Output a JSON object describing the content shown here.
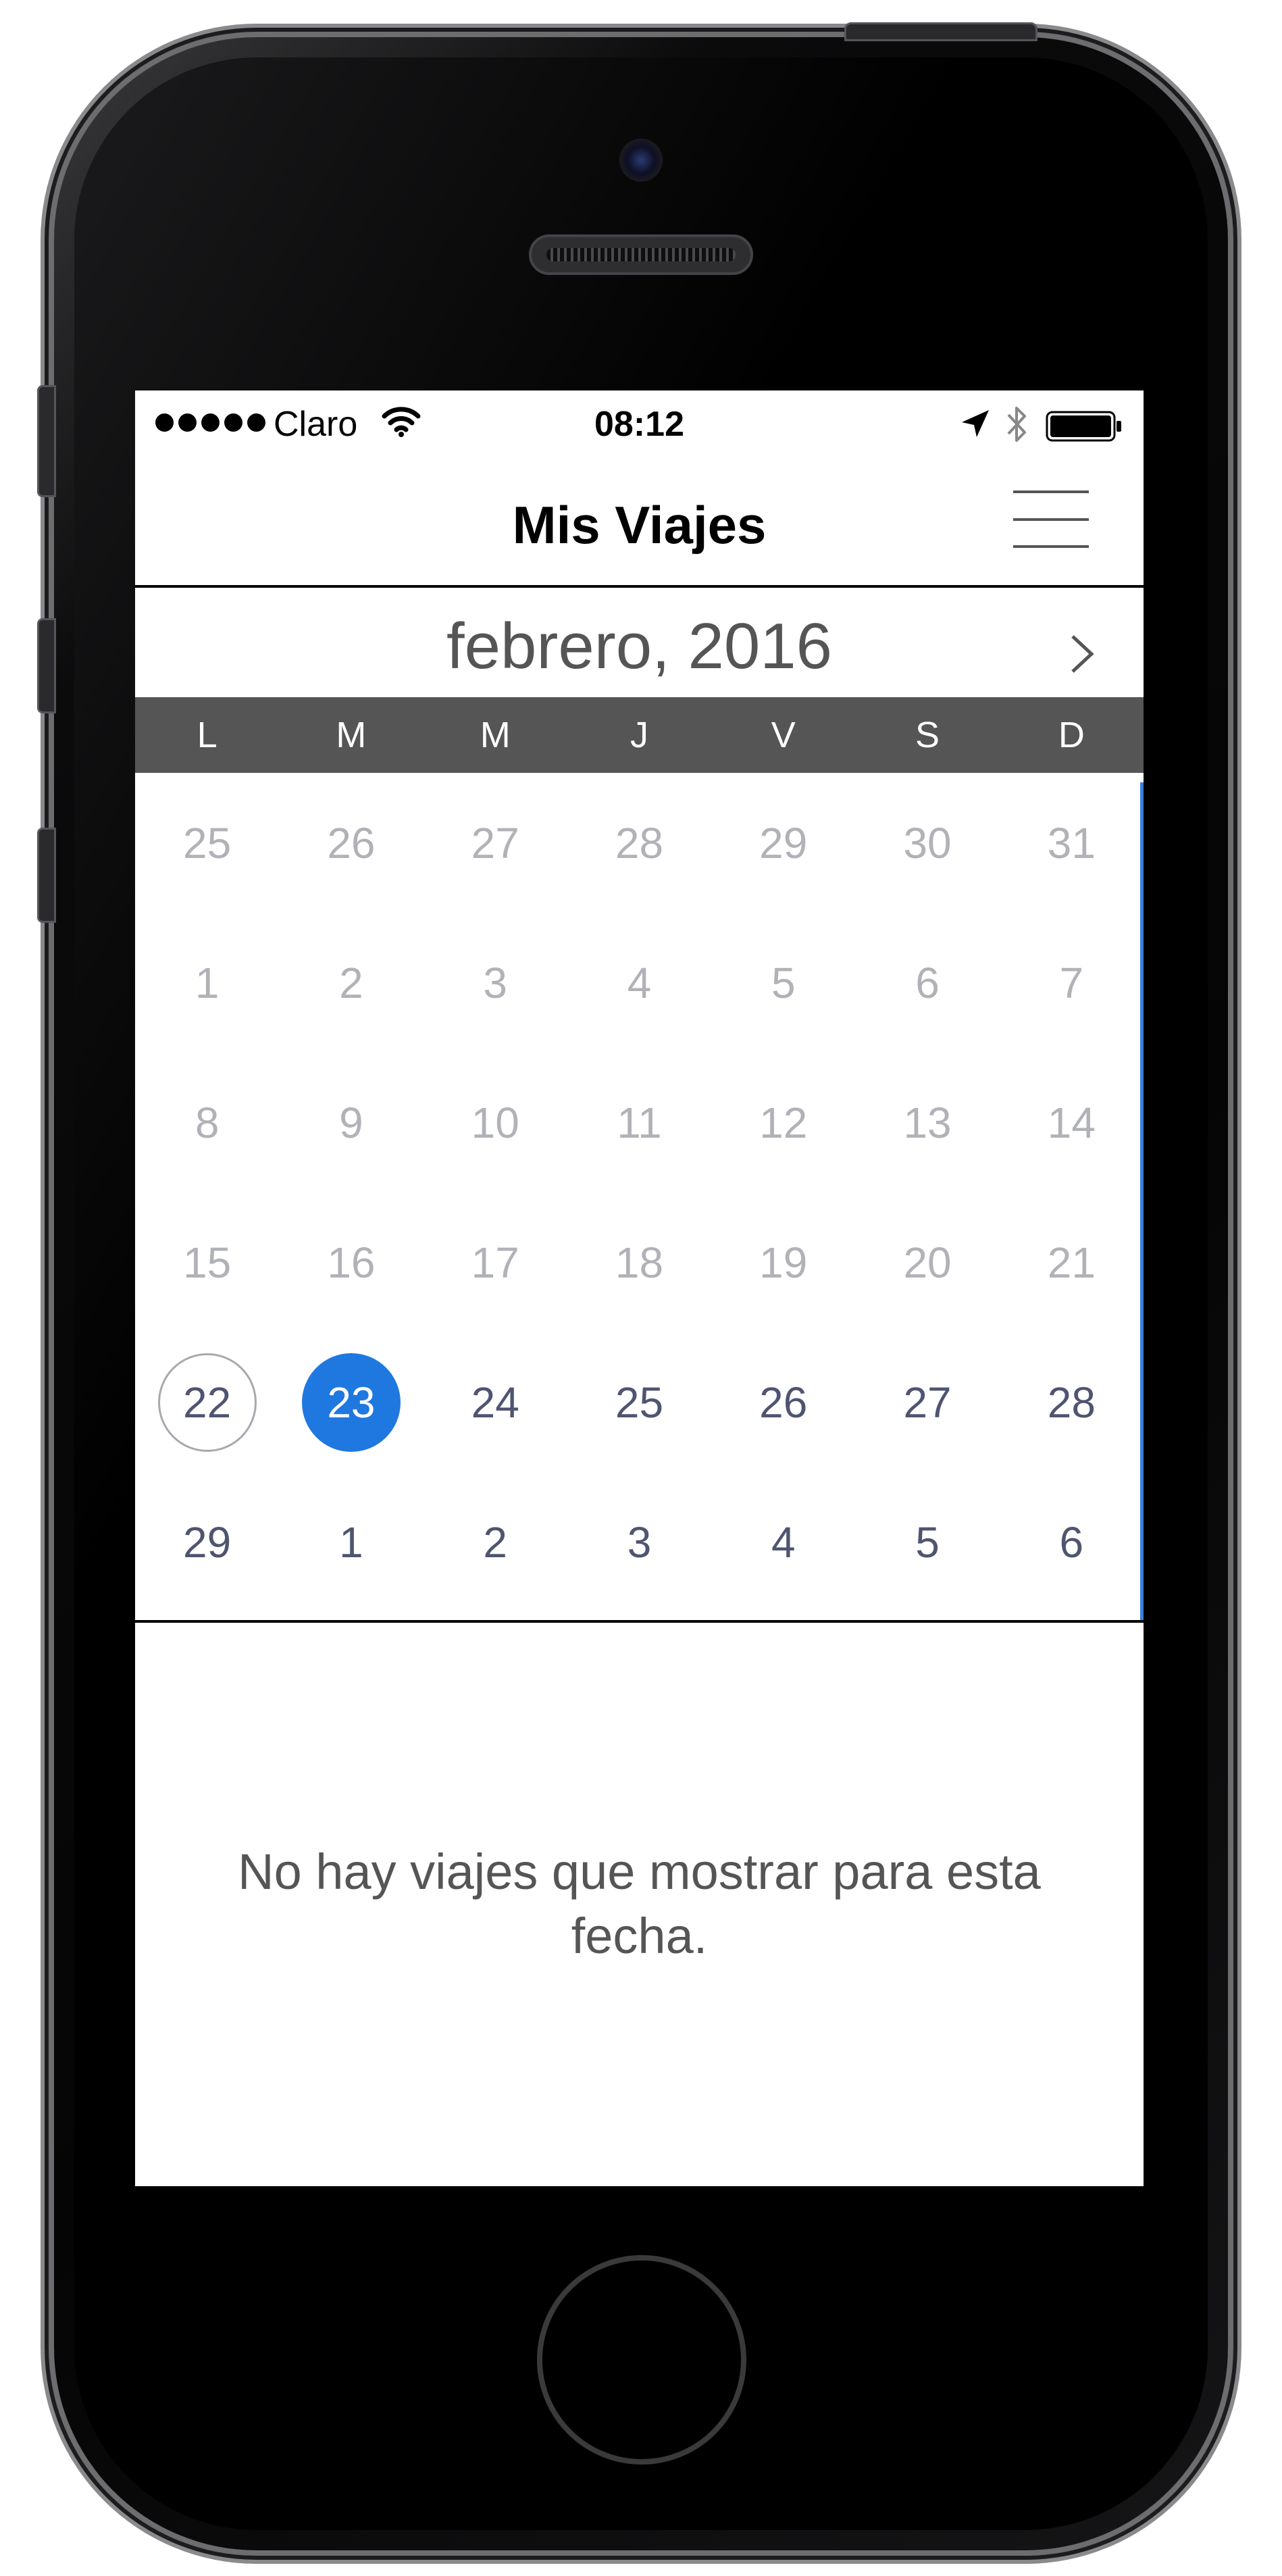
{
  "status_bar": {
    "carrier": "Claro",
    "time": "08:12",
    "signal_bars": 5,
    "icons": [
      "wifi-icon",
      "location-arrow-icon",
      "bluetooth-icon",
      "battery-icon"
    ]
  },
  "nav": {
    "title": "Mis Viajes",
    "menu_icon": "hamburger-menu-icon"
  },
  "calendar": {
    "month_label": "febrero, 2016",
    "next_icon": "chevron-right-icon",
    "weekdays": [
      "L",
      "M",
      "M",
      "J",
      "V",
      "S",
      "D"
    ],
    "weeks": [
      [
        "25",
        "26",
        "27",
        "28",
        "29",
        "30",
        "31"
      ],
      [
        "1",
        "2",
        "3",
        "4",
        "5",
        "6",
        "7"
      ],
      [
        "8",
        "9",
        "10",
        "11",
        "12",
        "13",
        "14"
      ],
      [
        "15",
        "16",
        "17",
        "18",
        "19",
        "20",
        "21"
      ],
      [
        "22",
        "23",
        "24",
        "25",
        "26",
        "27",
        "28"
      ],
      [
        "29",
        "1",
        "2",
        "3",
        "4",
        "5",
        "6"
      ]
    ],
    "today": "22",
    "selected": "23",
    "colors": {
      "selected": "#1f78e0",
      "past_day": "#b1b2b8",
      "upcoming_day": "#4f5470",
      "weekday_bar": "#555555"
    }
  },
  "empty_state": {
    "message": "No hay viajes que mostrar para esta fecha."
  }
}
